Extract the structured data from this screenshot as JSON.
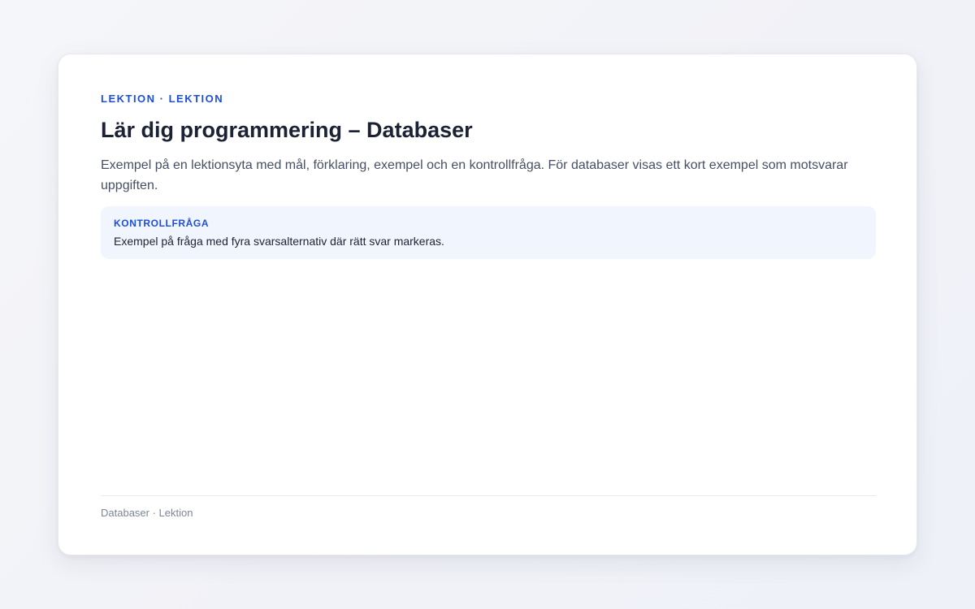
{
  "lesson": {
    "eyebrow": "LEKTION · LEKTION",
    "title": "Lär dig programmering – Databaser",
    "intro": "Exempel på en lektionsyta med mål, förklaring, exempel och en kontrollfråga. För databaser visas ett kort exempel som motsvarar uppgiften."
  },
  "quiz": {
    "label": "KONTROLLFRÅGA",
    "text": "Exempel på fråga med fyra svarsalternativ där rätt svar markeras."
  },
  "footer": {
    "text": "Databaser · Lektion"
  },
  "colors": {
    "accent": "#1d4ed8",
    "title": "#1b2233",
    "quiz_background": "#f1f5fe"
  }
}
